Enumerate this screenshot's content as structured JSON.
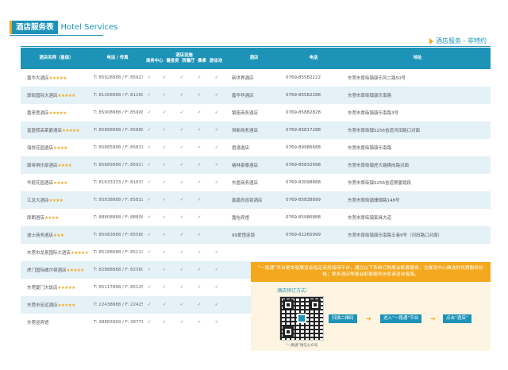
{
  "title": {
    "zh": "酒店服务表",
    "en": "Hotel Services"
  },
  "subhead": "酒店服务 - 非特约",
  "left_headers": {
    "name": "酒店名称（星级）",
    "tel": "电话 / 传真",
    "facilities": "酒店设施",
    "fac_cols": [
      "商务中心",
      "健身房",
      "西餐厅",
      "桑拿",
      "游泳池"
    ]
  },
  "right_headers": {
    "name": "酒店",
    "tel": "电话",
    "addr": "地址"
  },
  "check_mark": "✓",
  "left_rows": [
    {
      "name": "嘉华大酒店",
      "stars": "★★★★★",
      "tel": "T: 85928888 / F: 85923888",
      "fac": [
        1,
        1,
        1,
        1,
        1
      ]
    },
    {
      "name": "厚街国际大酒店",
      "stars": "★★★★★",
      "tel": "T: 81268888 / F: 81268888",
      "fac": [
        1,
        1,
        1,
        1,
        1
      ]
    },
    {
      "name": "嘉来登酒店",
      "stars": "★★★★★",
      "tel": "T: 85908888 / F: 85908888",
      "fac": [
        1,
        1,
        1,
        1,
        1
      ]
    },
    {
      "name": "富盈熙高莱爵酒店",
      "stars": "★★★★★",
      "tel": "T: 85888888 / F: 85888889",
      "fac": [
        1,
        1,
        1,
        1,
        1
      ]
    },
    {
      "name": "海悦花园酒店",
      "stars": "★★★★",
      "tel": "T: 85885888 / F: 85831837",
      "fac": [
        1,
        1,
        1,
        1,
        1
      ]
    },
    {
      "name": "康帝俱乐部酒店",
      "stars": "★★★★",
      "tel": "T: 85889988 / F: 85927666",
      "fac": [
        1,
        1,
        1,
        1,
        1
      ]
    },
    {
      "name": "华庭花园酒店",
      "stars": "★★★★",
      "tel": "T: 81633333 / F: 81633322",
      "fac": [
        1,
        1,
        1,
        1,
        1
      ]
    },
    {
      "name": "江龙大酒店",
      "stars": "★★★★",
      "tel": "T: 85838888 / F: 85832788",
      "fac": [
        1,
        1,
        1,
        1,
        0
      ]
    },
    {
      "name": "厚朗酒店",
      "stars": "★★★★",
      "tel": "T: 88808888 / F: 88808899",
      "fac": [
        1,
        1,
        1,
        1,
        0
      ]
    },
    {
      "name": "波士商务酒店",
      "stars": "★★★",
      "tel": "T: 85083888 / F: 85588008",
      "fac": [
        1,
        1,
        1,
        1,
        0
      ]
    },
    {
      "name": "东莞市龙泉国际大酒店",
      "stars": "★★★★★",
      "tel": "T: 85188688 / F: 85113855",
      "fac": [
        1,
        1,
        1,
        1,
        1
      ]
    },
    {
      "name": "虎门国际威尔顿酒店",
      "stars": "★★★★★",
      "tel": "T: 82888888 / F: 82360999",
      "fac": [
        1,
        1,
        1,
        1,
        1
      ]
    },
    {
      "name": "东莞厦门大饭店",
      "stars": "★★★★★",
      "tel": "T: 85117888 / F: 85125479",
      "fac": [
        1,
        1,
        1,
        1,
        1
      ]
    },
    {
      "name": "东莞市宏远酒店",
      "stars": "★★★★★",
      "tel": "T: 22438888 / F: 22425553",
      "fac": [
        1,
        1,
        1,
        1,
        1
      ]
    },
    {
      "name": "东莞迎宾馆",
      "stars": "",
      "tel": "T: 38883999 / F: 38771111",
      "fac": [
        1,
        1,
        1,
        1,
        1
      ]
    }
  ],
  "right_rows": [
    {
      "name": "新世界酒店",
      "tel": "0769-85582222",
      "addr": "东莞市厚街镇康乐风二路50号"
    },
    {
      "name": "嘉华华酒店",
      "tel": "0769-85582288",
      "addr": "东莞市厚街镇康乐南路"
    },
    {
      "name": "银座商务酒店",
      "tel": "0769-85882828",
      "addr": "东莞市厚街镇康乐南路3号"
    },
    {
      "name": "恒新商务酒店",
      "tel": "0769-85817288",
      "addr": "东莞市厚街镇S256省道河田路口对面"
    },
    {
      "name": "君濠酒店",
      "tel": "0769-89986688",
      "addr": "东莞市厚街镇康乐南路"
    },
    {
      "name": "格林豪泰酒店",
      "tel": "0769-85832998",
      "addr": "东莞市厚街镇虎大路横岗路对面"
    },
    {
      "name": "东盈商务酒店",
      "tel": "0769-83098888",
      "addr": "东莞市厚街镇S256省道寮厦路段"
    },
    {
      "name": "鑫嘉尚连锁酒店",
      "tel": "0769-85838899",
      "addr": "东莞市厚街镇珊瑚路148号"
    },
    {
      "name": "嘉怡宾馆",
      "tel": "0769-85986888",
      "addr": "东莞市厚街镇家具大道"
    },
    {
      "name": "99爱馆连锁",
      "tel": "0769-81265999",
      "addr": "东莞市厚街镇康乐南路五巷9号（河田路口对面）"
    }
  ],
  "booking": {
    "notice": "“一路通”平台是本届展览会指定商务接待平台，通过以下系统订购展会配套服务，含展览中心精选的优惠服务价格；更多酒店等展会配套服务信息请咨询客服。",
    "method_label": "酒店预订方式：",
    "qr_caption": "“一路通”微信公众号",
    "steps": [
      "扫描二维码",
      "进入“一路通”平台",
      "点击“酒店”"
    ]
  }
}
